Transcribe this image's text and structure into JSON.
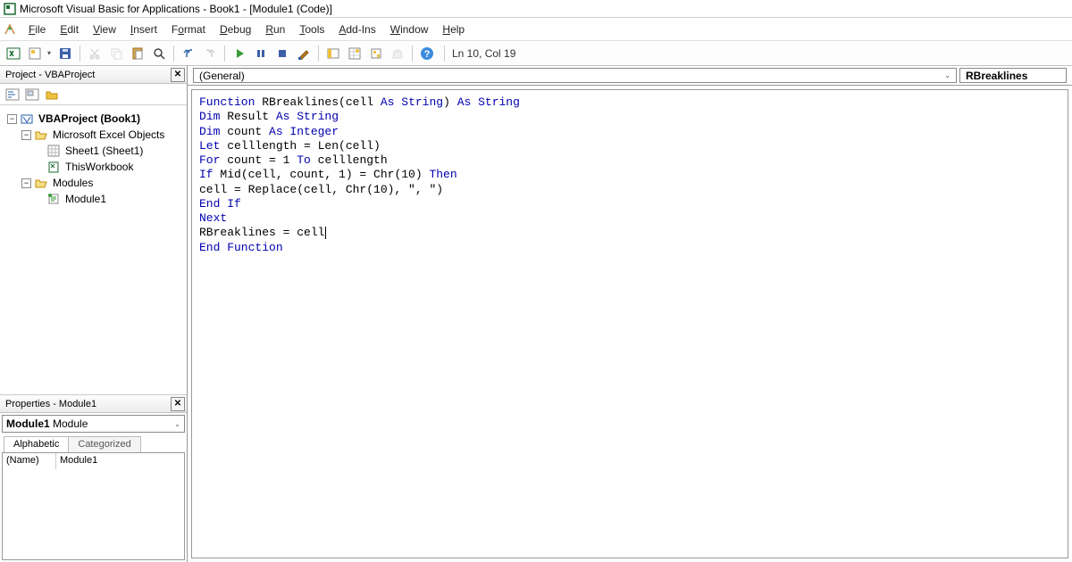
{
  "title": "Microsoft Visual Basic for Applications - Book1 - [Module1 (Code)]",
  "menu": {
    "file": "File",
    "edit": "Edit",
    "view": "View",
    "insert": "Insert",
    "format": "Format",
    "debug": "Debug",
    "run": "Run",
    "tools": "Tools",
    "addins": "Add-Ins",
    "window": "Window",
    "help": "Help"
  },
  "toolbar": {
    "pos": "Ln 10, Col 19"
  },
  "project_pane": {
    "title": "Project - VBAProject",
    "tree": {
      "root": "VBAProject (Book1)",
      "excel_objects": "Microsoft Excel Objects",
      "sheet1": "Sheet1 (Sheet1)",
      "thiswb": "ThisWorkbook",
      "modules": "Modules",
      "module1": "Module1"
    }
  },
  "props": {
    "title": "Properties - Module1",
    "obj_name": "Module1",
    "obj_type": " Module",
    "tab_alpha": "Alphabetic",
    "tab_cat": "Categorized",
    "name_key": "(Name)",
    "name_val": "Module1"
  },
  "code_header": {
    "left": "(General)",
    "right": "RBreaklines"
  },
  "code": {
    "l1a": "Function",
    "l1b": " RBreaklines(cell ",
    "l1c": "As String",
    "l1d": ") ",
    "l1e": "As String",
    "l2a": "Dim",
    "l2b": " Result ",
    "l2c": "As String",
    "l3a": "Dim",
    "l3b": " count ",
    "l3c": "As Integer",
    "l4a": "Let",
    "l4b": " celllength = Len(cell)",
    "l5a": "For",
    "l5b": " count = 1 ",
    "l5c": "To",
    "l5d": " celllength",
    "l6a": "If",
    "l6b": " Mid(cell, count, 1) = Chr(10) ",
    "l6c": "Then",
    "l7": "cell = Replace(cell, Chr(10), \", \")",
    "l8": "End If",
    "l9": "Next",
    "l10": "RBreaklines = cell",
    "l11": "End Function"
  }
}
